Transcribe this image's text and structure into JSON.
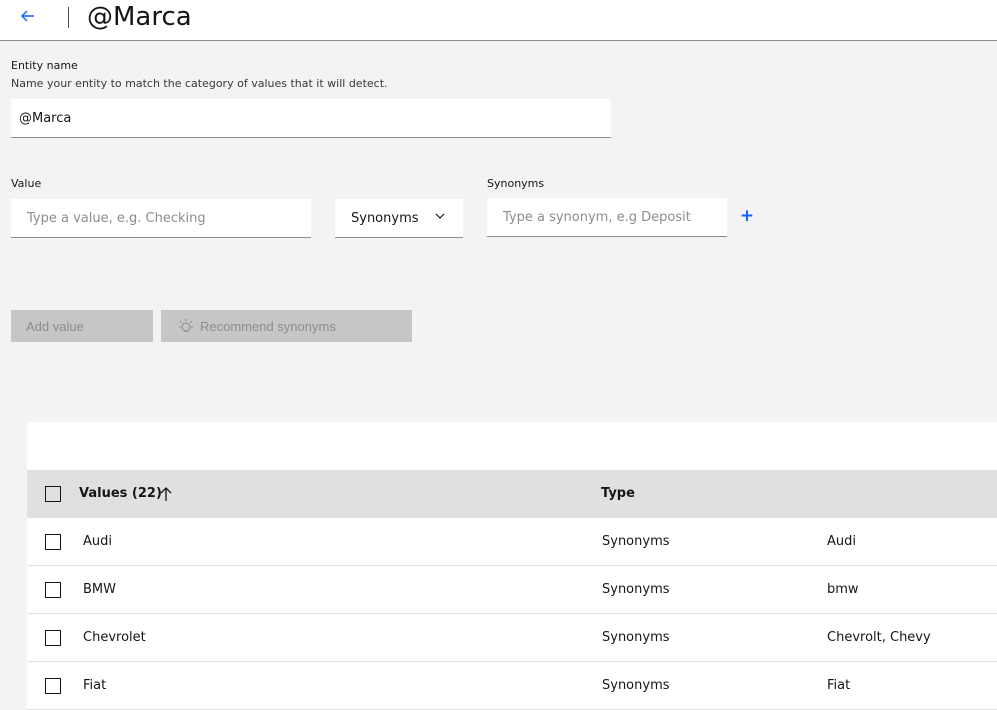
{
  "header": {
    "title": "@Marca",
    "back_icon": "arrow-left-icon"
  },
  "entity": {
    "label": "Entity name",
    "help": "Name your entity to match the category of values that it will detect.",
    "value": "@Marca"
  },
  "value_input": {
    "label": "Value",
    "placeholder": "Type a value, e.g. Checking"
  },
  "type_dropdown": {
    "selected": "Synonyms"
  },
  "synonyms_input": {
    "label": "Synonyms",
    "placeholder": "Type a synonym, e.g Deposit"
  },
  "buttons": {
    "add_value": "Add value",
    "recommend": "Recommend synonyms"
  },
  "table": {
    "col_values": "Values (22)",
    "col_type": "Type",
    "rows": [
      {
        "value": "Audi",
        "type": "Synonyms",
        "synonyms": "Audi"
      },
      {
        "value": "BMW",
        "type": "Synonyms",
        "synonyms": "bmw"
      },
      {
        "value": "Chevrolet",
        "type": "Synonyms",
        "synonyms": "Chevrolt, Chevy"
      },
      {
        "value": "Fiat",
        "type": "Synonyms",
        "synonyms": "Fiat"
      }
    ]
  },
  "colors": {
    "accent": "#0f62fe",
    "disabled_bg": "#c6c6c6",
    "header_bg": "#e0e0e0"
  }
}
